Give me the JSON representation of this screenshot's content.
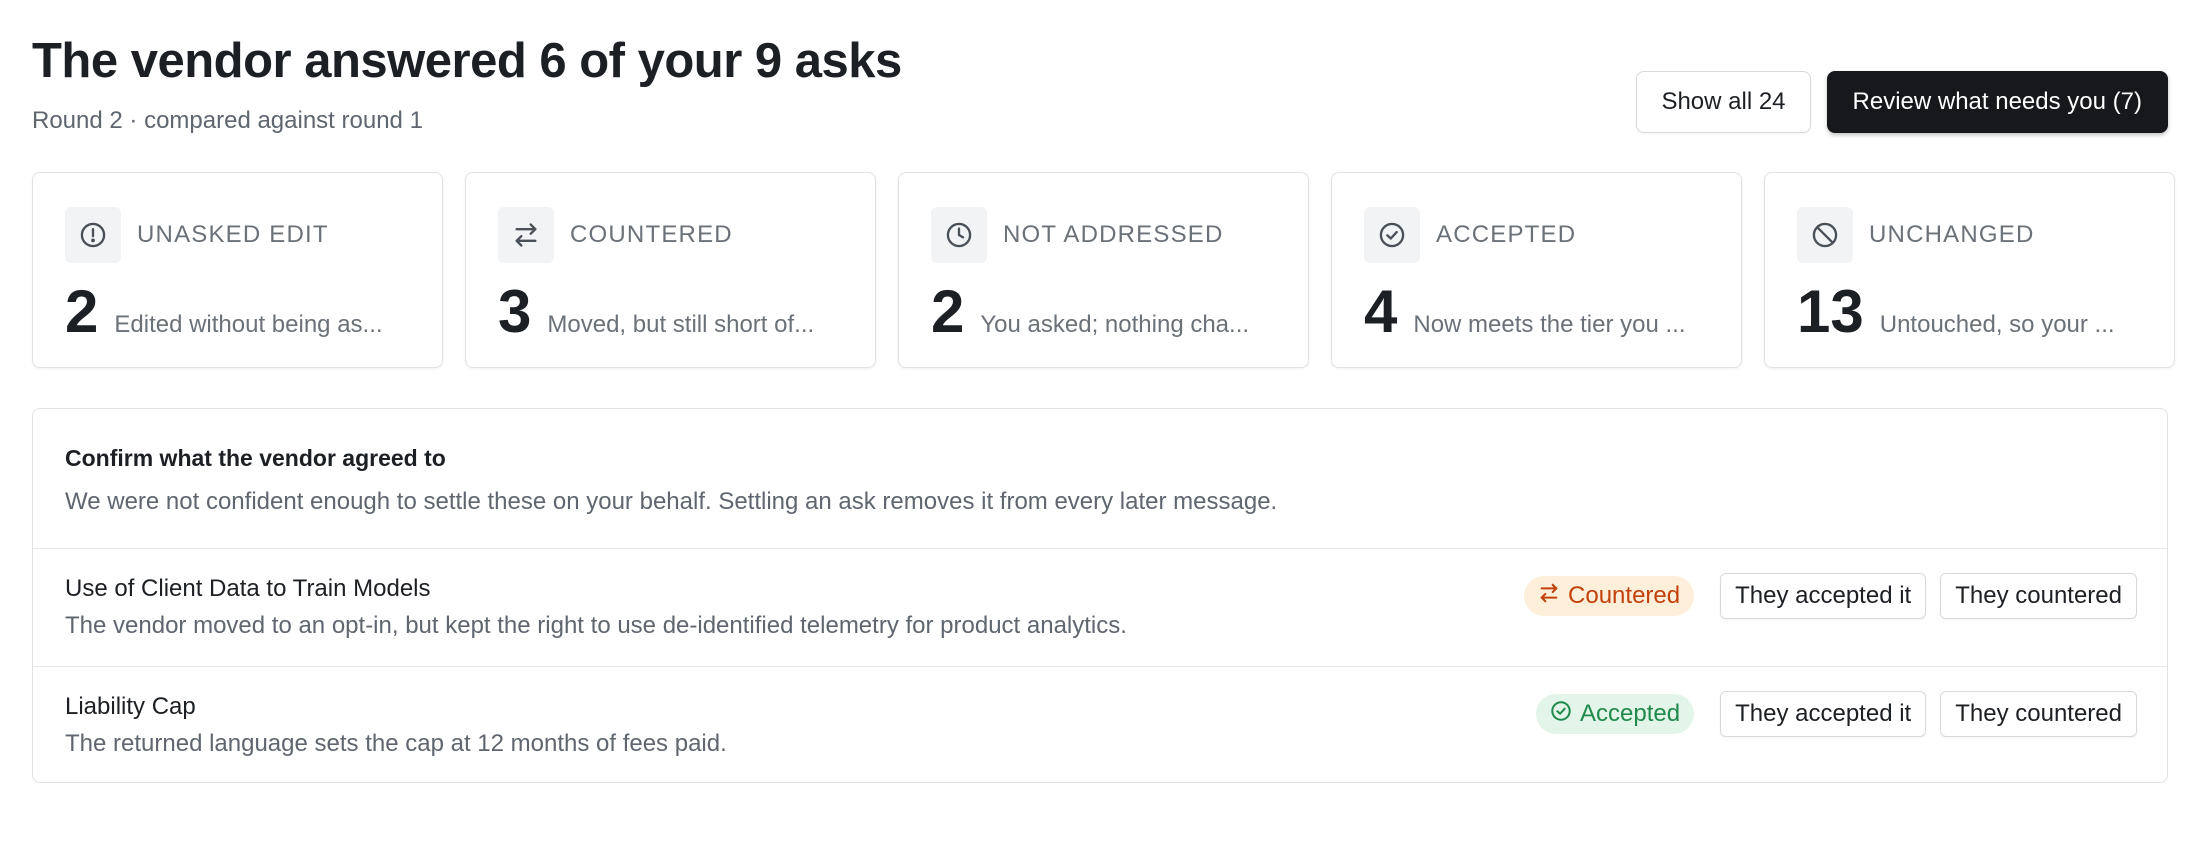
{
  "header": {
    "title": "The vendor answered 6 of your 9 asks",
    "subtitle": "Round 2 · compared against round 1",
    "show_all_label": "Show all 24",
    "review_label": "Review what needs you (7)"
  },
  "summary_cards": [
    {
      "icon": "exclamation-circle-icon",
      "label": "UNASKED EDIT",
      "count": "2",
      "description": "Edited without being as..."
    },
    {
      "icon": "swap-arrows-icon",
      "label": "COUNTERED",
      "count": "3",
      "description": "Moved, but still short of..."
    },
    {
      "icon": "clock-icon",
      "label": "NOT ADDRESSED",
      "count": "2",
      "description": "You asked; nothing cha..."
    },
    {
      "icon": "check-circle-icon",
      "label": "ACCEPTED",
      "count": "4",
      "description": "Now meets the tier you ..."
    },
    {
      "icon": "prohibited-icon",
      "label": "UNCHANGED",
      "count": "13",
      "description": "Untouched, so your ..."
    }
  ],
  "confirm_panel": {
    "title": "Confirm what the vendor agreed to",
    "description": "We were not confident enough to settle these on your behalf. Settling an ask removes it from every later message.",
    "rows": [
      {
        "title": "Use of Client Data to Train Models",
        "description": "The vendor moved to an opt-in, but kept the right to use de-identified telemetry for product analytics.",
        "badge": "Countered",
        "badge_icon": "swap-arrows-icon",
        "accept_label": "They accepted it",
        "counter_label": "They countered"
      },
      {
        "title": "Liability Cap",
        "description": "The returned language sets the cap at 12 months of fees paid.",
        "badge": "Accepted",
        "badge_icon": "check-circle-icon",
        "accept_label": "They accepted it",
        "counter_label": "They countered"
      }
    ]
  },
  "colors": {
    "primary_button": "#16181b",
    "countered": "#c2410c",
    "countered_bg": "#fdefd9",
    "accepted": "#1f8a4c",
    "accepted_bg": "#e3f4e8"
  }
}
